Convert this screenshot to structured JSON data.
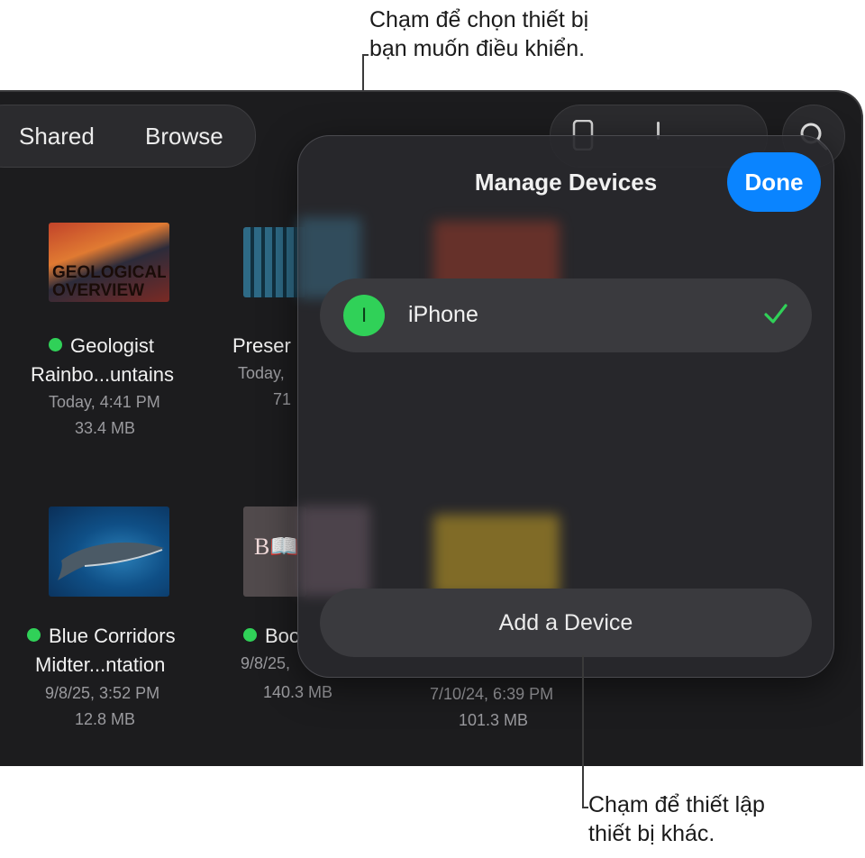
{
  "callouts": {
    "top_line1": "Chạm để chọn thiết bị",
    "top_line2": "bạn muốn điều khiển.",
    "bottom_line1": "Chạm để thiết lập",
    "bottom_line2": "thiết bị khác."
  },
  "tabs": {
    "shared": "Shared",
    "browse": "Browse"
  },
  "documents": [
    {
      "name1": "Geologist",
      "name2": "Rainbo...untains",
      "date": "Today, 4:41 PM",
      "size": "33.4 MB",
      "thumb_text": "GEOLOGICAL OVERVIEW"
    },
    {
      "name1": "Preser",
      "date": "Today,",
      "size": "71"
    },
    {
      "name1": "Blue Corridors",
      "name2": "Midter...ntation",
      "date": "9/8/25, 3:52 PM",
      "size": "12.8 MB"
    },
    {
      "name1": "Boo",
      "date": "9/8/25,",
      "size": "140.3 MB",
      "thumb_text": "B📖"
    },
    {
      "date": "7/10/24, 6:39 PM",
      "size": "101.3 MB"
    }
  ],
  "sheet": {
    "title": "Manage Devices",
    "done": "Done",
    "device_initial": "I",
    "device_name": "iPhone",
    "add_device": "Add a Device"
  },
  "colors": {
    "accent": "#0a84ff",
    "status_green": "#30d158",
    "background": "#1c1c1e"
  },
  "icons": [
    "phone-icon",
    "search-icon",
    "checkmark-icon",
    "status-dot-icon"
  ]
}
